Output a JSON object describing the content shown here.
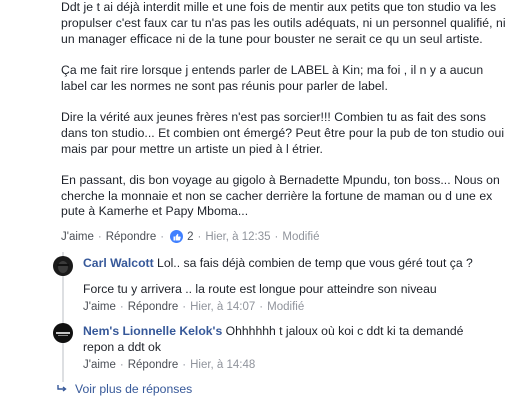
{
  "main_comment": {
    "paragraphs": [
      "Ddt je t ai déjà interdit mille et une fois de mentir aux petits que ton studio va les propulser c'est faux car tu n'as pas les outils adéquats, ni un personnel qualifié, ni un manager efficace ni de la tune pour bouster ne serait ce qu un seul artiste.",
      "Ça me fait rire lorsque j entends parler de LABEL à Kin; ma foi , il n y a aucun label car les normes ne sont pas réunis pour parler de label.",
      "Dire la vérité aux jeunes frères n'est pas sorcier!!! Combien tu as fait des sons dans ton studio... Et combien ont émergé? Peut être pour la pub de ton studio oui mais par pour mettre un artiste un pied à l étrier.",
      "En passant, dis bon voyage au gigolo à Bernadette Mpundu, ton boss... Nous on cherche la monnaie et non se cacher derrière la fortune de maman ou d une ex pute à Kamerhe et Papy Mboma..."
    ],
    "actions": {
      "like": "J'aime",
      "reply": "Répondre",
      "like_count": "2",
      "time": "Hier, à 12:35",
      "edited": "Modifié"
    }
  },
  "replies": [
    {
      "author": "Carl Walcott",
      "text_line1": "Lol.. sa fais déjà combien de temp que vous géré tout ça ?",
      "text_line2": "Force tu y arrivera .. la route est longue pour atteindre son niveau",
      "like": "J'aime",
      "reply": "Répondre",
      "time": "Hier, à 14:07",
      "edited": "Modifié"
    },
    {
      "author": "Nem's Lionnelle Kelok's",
      "text_line1": "Ohhhhhh t jaloux où koi c ddt ki ta demandé",
      "text_line2": "repon a ddt ok",
      "like": "J'aime",
      "reply": "Répondre",
      "time": "Hier, à 14:48"
    }
  ],
  "view_more": "Voir plus de réponses",
  "colors": {
    "link": "#365899",
    "meta": "#90949c",
    "text": "#1d2129",
    "like_badge": "#4080ff"
  }
}
